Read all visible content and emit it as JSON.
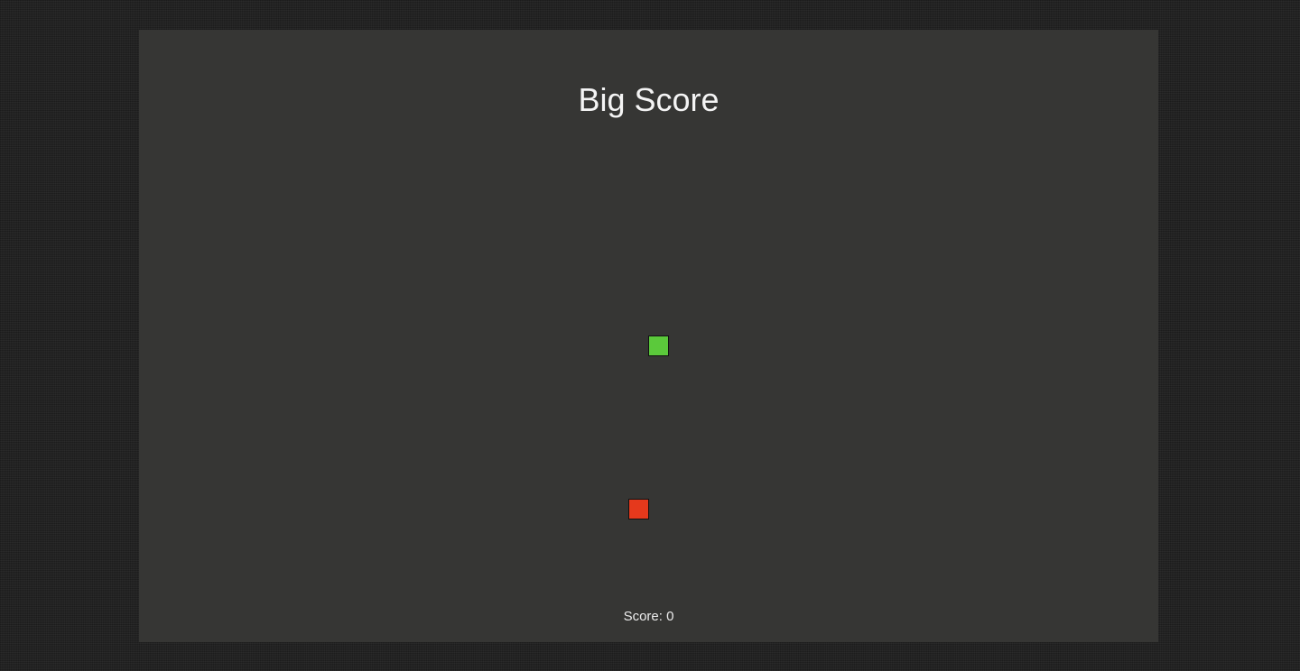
{
  "game": {
    "title": "Big Score",
    "score_text": "Score: 0",
    "score_value": 0
  },
  "entities": {
    "player": {
      "name": "green-block",
      "color": "#5bc93b"
    },
    "enemy": {
      "name": "red-block",
      "color": "#e5391c"
    }
  },
  "colors": {
    "page_background": "#222222",
    "board_background": "#363634",
    "text": "#f4f4f4"
  }
}
